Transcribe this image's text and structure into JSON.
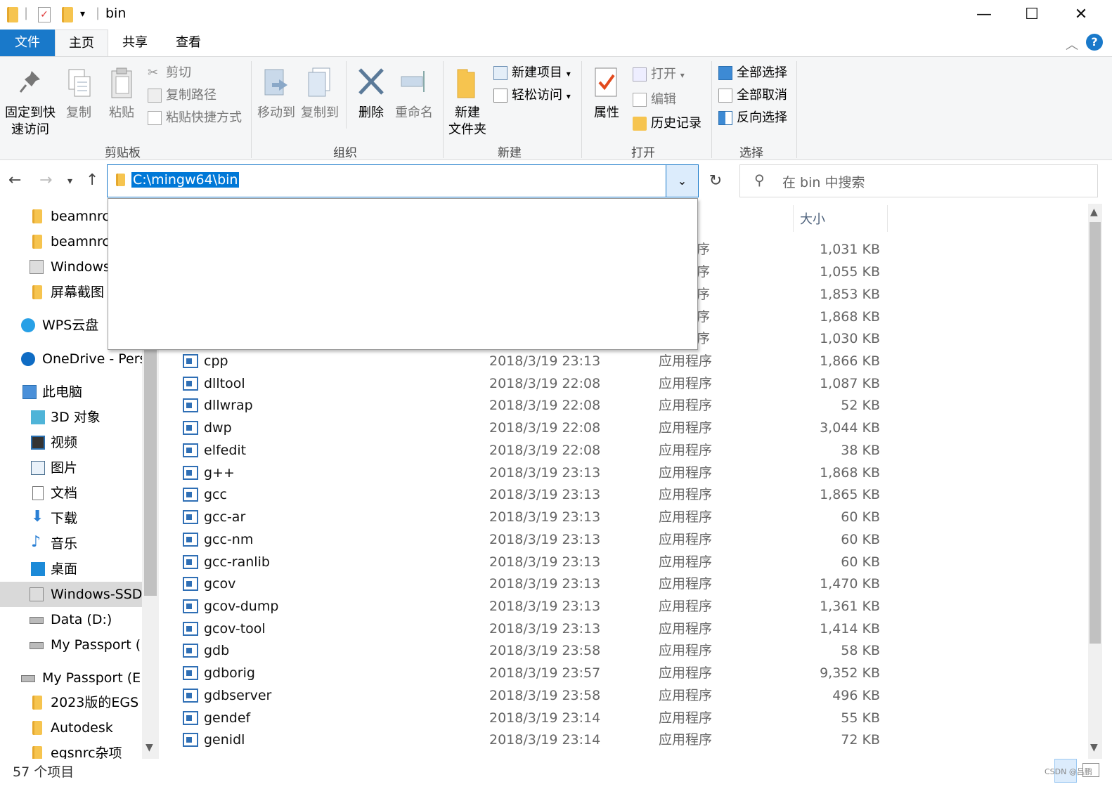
{
  "window": {
    "title": "bin",
    "minimize": "—",
    "maximize": "☐",
    "close": "✕"
  },
  "tabs": [
    {
      "label": "文件"
    },
    {
      "label": "主页"
    },
    {
      "label": "共享"
    },
    {
      "label": "查看"
    }
  ],
  "ribbon": {
    "clipboard": {
      "pin_line1": "固定到快",
      "pin_line2": "速访问",
      "copy": "复制",
      "paste": "粘贴",
      "cut": "剪切",
      "copy_path": "复制路径",
      "paste_shortcut": "粘贴快捷方式",
      "label": "剪贴板"
    },
    "organize": {
      "move_to": "移动到",
      "copy_to": "复制到",
      "delete": "删除",
      "rename": "重命名",
      "label": "组织"
    },
    "new": {
      "new_folder_line1": "新建",
      "new_folder_line2": "文件夹",
      "new_item": "新建项目",
      "easy_access": "轻松访问",
      "label": "新建"
    },
    "open": {
      "properties": "属性",
      "open": "打开",
      "edit": "编辑",
      "history": "历史记录",
      "label": "打开"
    },
    "select": {
      "select_all": "全部选择",
      "select_none": "全部取消",
      "invert": "反向选择",
      "label": "选择"
    }
  },
  "address": {
    "path": "C:\\mingw64\\bin",
    "search_placeholder": "在 bin 中搜索"
  },
  "nav_pane": {
    "items": [
      {
        "label": "beamnrc"
      },
      {
        "label": "beamnrc"
      },
      {
        "label": "Windows-"
      },
      {
        "label": "屏幕截图"
      },
      {
        "label": "WPS云盘"
      },
      {
        "label": "OneDrive - Perso"
      },
      {
        "label": "此电脑"
      },
      {
        "label": "3D 对象"
      },
      {
        "label": "视频"
      },
      {
        "label": "图片"
      },
      {
        "label": "文档"
      },
      {
        "label": "下载"
      },
      {
        "label": "音乐"
      },
      {
        "label": "桌面"
      },
      {
        "label": "Windows-SSD ("
      },
      {
        "label": "Data (D:)"
      },
      {
        "label": "My Passport (E:"
      },
      {
        "label": "My Passport (E:)"
      },
      {
        "label": "2023版的EGS"
      },
      {
        "label": "Autodesk"
      },
      {
        "label": "egsnrc杂项"
      }
    ]
  },
  "file_list": {
    "header_size": "大小",
    "partial_rows": [
      {
        "type": "序",
        "size": "1,031 KB"
      },
      {
        "type": "序",
        "size": "1,055 KB"
      },
      {
        "type": "序",
        "size": "1,853 KB"
      },
      {
        "type": "序",
        "size": "1,868 KB"
      },
      {
        "type": "序",
        "size": "1,030 KB"
      }
    ],
    "rows": [
      {
        "name": "cpp",
        "date": "2018/3/19 23:13",
        "type": "应用程序",
        "size": "1,866 KB"
      },
      {
        "name": "dlltool",
        "date": "2018/3/19 22:08",
        "type": "应用程序",
        "size": "1,087 KB"
      },
      {
        "name": "dllwrap",
        "date": "2018/3/19 22:08",
        "type": "应用程序",
        "size": "52 KB"
      },
      {
        "name": "dwp",
        "date": "2018/3/19 22:08",
        "type": "应用程序",
        "size": "3,044 KB"
      },
      {
        "name": "elfedit",
        "date": "2018/3/19 22:08",
        "type": "应用程序",
        "size": "38 KB"
      },
      {
        "name": "g++",
        "date": "2018/3/19 23:13",
        "type": "应用程序",
        "size": "1,868 KB"
      },
      {
        "name": "gcc",
        "date": "2018/3/19 23:13",
        "type": "应用程序",
        "size": "1,865 KB"
      },
      {
        "name": "gcc-ar",
        "date": "2018/3/19 23:13",
        "type": "应用程序",
        "size": "60 KB"
      },
      {
        "name": "gcc-nm",
        "date": "2018/3/19 23:13",
        "type": "应用程序",
        "size": "60 KB"
      },
      {
        "name": "gcc-ranlib",
        "date": "2018/3/19 23:13",
        "type": "应用程序",
        "size": "60 KB"
      },
      {
        "name": "gcov",
        "date": "2018/3/19 23:13",
        "type": "应用程序",
        "size": "1,470 KB"
      },
      {
        "name": "gcov-dump",
        "date": "2018/3/19 23:13",
        "type": "应用程序",
        "size": "1,361 KB"
      },
      {
        "name": "gcov-tool",
        "date": "2018/3/19 23:13",
        "type": "应用程序",
        "size": "1,414 KB"
      },
      {
        "name": "gdb",
        "date": "2018/3/19 23:58",
        "type": "应用程序",
        "size": "58 KB"
      },
      {
        "name": "gdborig",
        "date": "2018/3/19 23:57",
        "type": "应用程序",
        "size": "9,352 KB"
      },
      {
        "name": "gdbserver",
        "date": "2018/3/19 23:58",
        "type": "应用程序",
        "size": "496 KB"
      },
      {
        "name": "gendef",
        "date": "2018/3/19 23:14",
        "type": "应用程序",
        "size": "55 KB"
      },
      {
        "name": "genidl",
        "date": "2018/3/19 23:14",
        "type": "应用程序",
        "size": "72 KB"
      }
    ]
  },
  "status": {
    "item_count": "57 个项目",
    "watermark": "CSDN @吕鹏"
  },
  "colors": {
    "accent": "#1979ca",
    "selection": "#0078d7",
    "ribbon_bg": "#f5f6f7"
  }
}
